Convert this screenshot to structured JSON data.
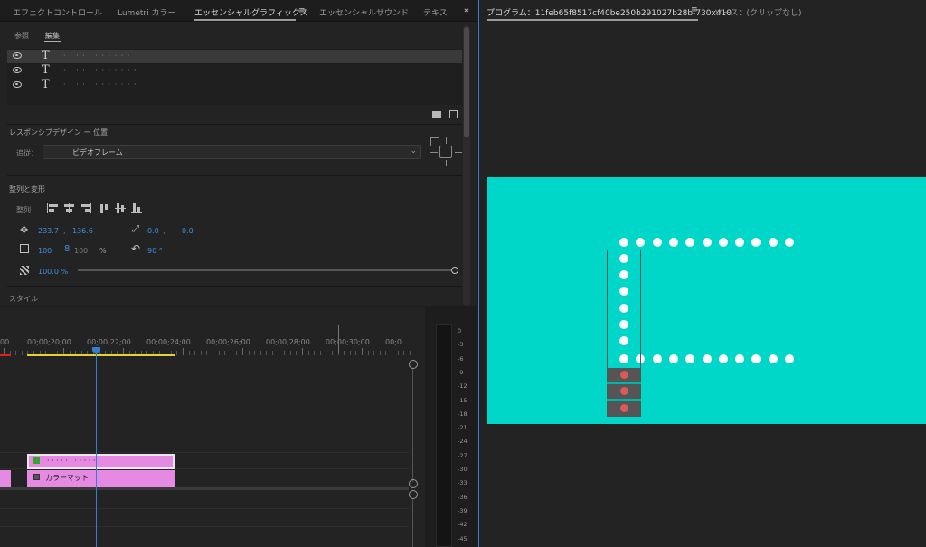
{
  "eg_panel": {
    "tabs": [
      "エフェクトコントロール",
      "Lumetri カラー",
      "エッセンシャルグラフィックス",
      "エッセンシャルサウンド",
      "テキス"
    ],
    "active_tab": "エッセンシャルグラフィックス",
    "tab_menu_icon": "≡",
    "overflow_icon": "»",
    "subtabs": [
      "参照",
      "編集"
    ],
    "layers": [
      {
        "icon": "T",
        "name": "· · · · · · · · · · ·"
      },
      {
        "icon": "T",
        "name": "· · · · · · · · · · · ·"
      },
      {
        "icon": "T",
        "name": "· · · · · · · · · · · ·"
      }
    ],
    "responsive_title": "レスポンシブデザイン ー 位置",
    "follow_label": "追従：",
    "follow_value": "ビデオフレーム",
    "align_title": "整列と変形",
    "align_label": "整列",
    "position_x": "233.7",
    "position_y": "136.6",
    "anchor_x": "0.0",
    "anchor_y": "0.0",
    "scale": "100",
    "scale_link": "100",
    "percent": "%",
    "rotation": "90 °",
    "opacity": "100.0 %",
    "style_title": "スタイル"
  },
  "timeline": {
    "ruler_labels": [
      "00",
      "00;00;20;00",
      "00;00;22;00",
      "00;00;24;00",
      "00;00;26;00",
      "00;00;28;00",
      "00;00;30;00",
      "00;0"
    ],
    "clip_text_label": "· · · · · · · · · · ·",
    "clip_matte_label": "カラーマット"
  },
  "meters": {
    "labels": [
      "0",
      "-3",
      "-6",
      "-9",
      "-12",
      "-15",
      "-18",
      "-21",
      "-24",
      "-27",
      "-30",
      "-33",
      "-36",
      "-39",
      "-42",
      "-45"
    ]
  },
  "program": {
    "title": "プログラム：11feb65f8517cf40be250b291027b28b-730x410",
    "menu_icon": "≡",
    "source_tab": "ソース：(クリップなし)",
    "frame_color": "#00d7c8"
  }
}
